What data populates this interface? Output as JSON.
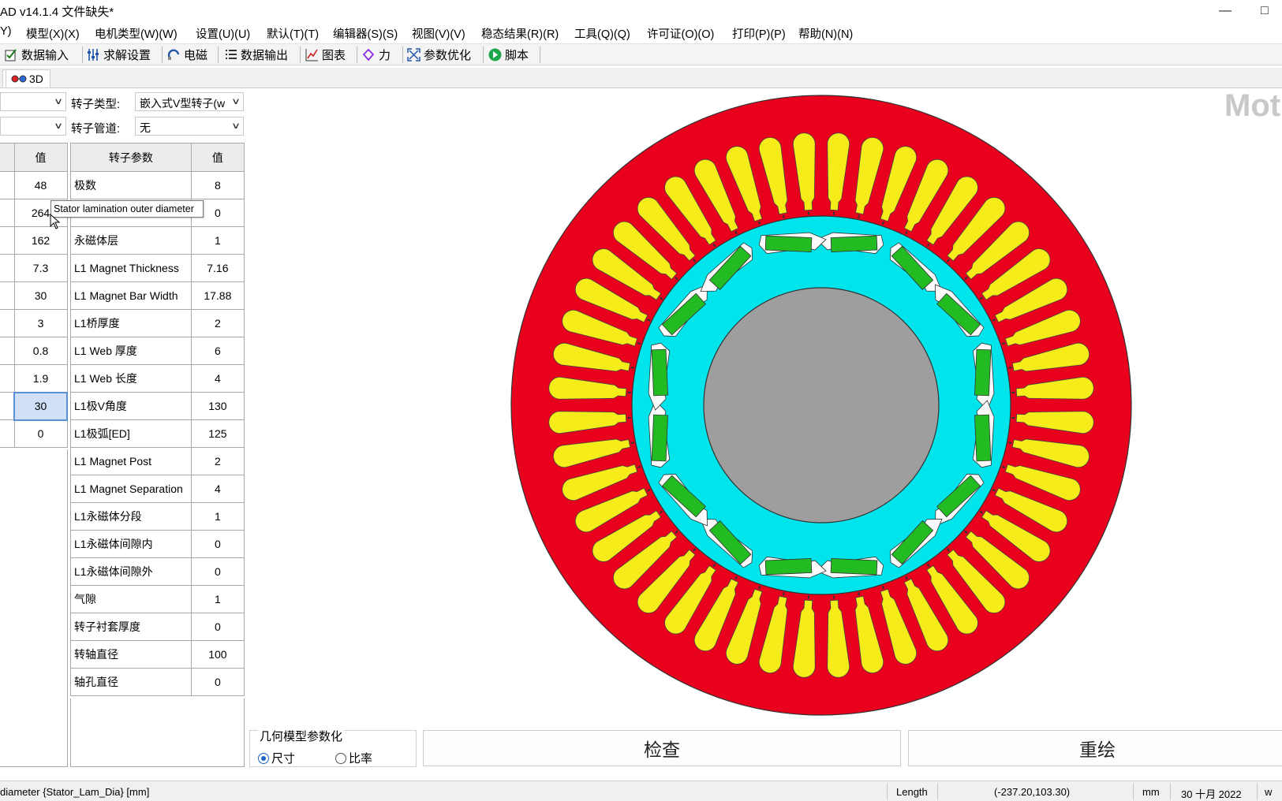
{
  "window": {
    "title": "AD v14.1.4 文件缺失*"
  },
  "menu": [
    "Y)",
    "模型(X)(X)",
    "电机类型(W)(W)",
    "设置(U)(U)",
    "默认(T)(T)",
    "编辑器(S)(S)",
    "视图(V)(V)",
    "稳态结果(R)(R)",
    "工具(Q)(Q)",
    "许可证(O)(O)",
    "打印(P)(P)",
    "帮助(N)(N)"
  ],
  "toolbar": [
    "数据输入",
    "求解设置",
    "电磁",
    "数据输出",
    "图表",
    "力",
    "参数优化",
    "脚本"
  ],
  "tabs": {
    "tab_3d": "3D"
  },
  "rotor_type": {
    "label": "转子类型:",
    "value": "嵌入式V型转子(w"
  },
  "rotor_duct": {
    "label": "转子管道:",
    "value": "无"
  },
  "left_table": {
    "header_value": "值",
    "values": [
      "48",
      "264",
      "162",
      "7.3",
      "30",
      "3",
      "0.8",
      "1.9",
      "30",
      "0"
    ]
  },
  "right_table": {
    "header_param": "转子参数",
    "header_value": "值",
    "rows": [
      [
        "极数",
        "8"
      ],
      [
        "",
        "0"
      ],
      [
        "永磁体层",
        "1"
      ],
      [
        "L1 Magnet Thickness",
        "7.16"
      ],
      [
        "L1 Magnet Bar Width",
        "17.88"
      ],
      [
        "L1桥厚度",
        "2"
      ],
      [
        " L1 Web 厚度",
        "6"
      ],
      [
        " L1 Web 长度",
        "4"
      ],
      [
        " L1极V角度",
        "130"
      ],
      [
        "L1极弧[ED]",
        "125"
      ],
      [
        "L1 Magnet Post",
        "2"
      ],
      [
        "L1 Magnet Separation",
        "4"
      ],
      [
        "L1永磁体分段",
        "1"
      ],
      [
        " L1永磁体间隙内",
        "0"
      ],
      [
        " L1永磁体间隙外",
        "0"
      ],
      [
        "气隙",
        "1"
      ],
      [
        "转子衬套厚度",
        "0"
      ],
      [
        "转轴直径",
        "100"
      ],
      [
        "轴孔直径",
        "0"
      ]
    ]
  },
  "tooltip": "Stator lamination outer diameter",
  "watermark": "Mot",
  "geometry_param": {
    "label": "几何模型参数化",
    "option_size": "尺寸",
    "option_ratio": "比率",
    "selected": "尺寸"
  },
  "buttons": {
    "check": "检查",
    "redraw": "重绘"
  },
  "status": {
    "hint": "diameter {Stator_Lam_Dia} [mm]",
    "measure": "Length",
    "coords": "(-237.20,103.30)",
    "unit": "mm",
    "date": "30 十月 2022",
    "tail": "w"
  },
  "colors": {
    "stator": "#e8001c",
    "winding": "#f5ec1a",
    "rotor": "#00e5ec",
    "magnet": "#22bb22",
    "shaft": "#9e9e9e"
  },
  "motor": {
    "slots": 48,
    "poles": 8
  }
}
